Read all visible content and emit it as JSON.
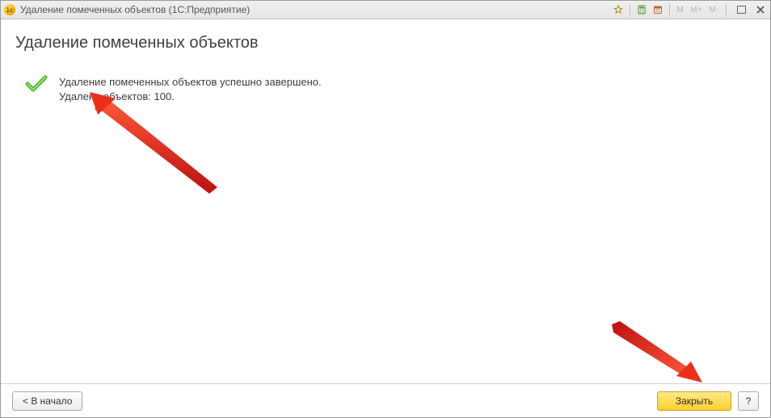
{
  "titlebar": {
    "app_icon_text": "1c",
    "title": "Удаление помеченных объектов  (1С:Предприятие)",
    "mem_labels": [
      "M",
      "M+",
      "M-"
    ]
  },
  "page": {
    "heading": "Удаление помеченных объектов",
    "success_line1": "Удаление помеченных объектов успешно завершено.",
    "success_line2": "Удалено объектов: 100."
  },
  "footer": {
    "back_label": "< В начало",
    "close_label": "Закрыть",
    "help_label": "?"
  }
}
